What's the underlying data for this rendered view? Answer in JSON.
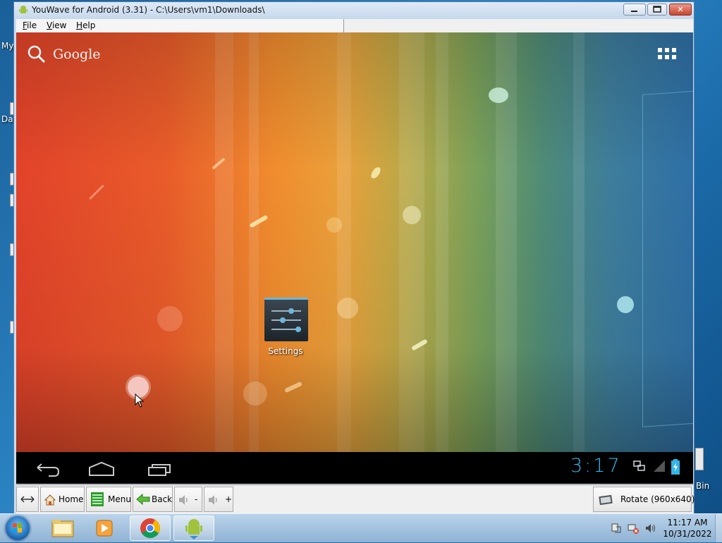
{
  "window": {
    "title": "YouWave for Android (3.31) - C:\\Users\\vm1\\Downloads\\",
    "minimize_glyph": "▭",
    "maximize_glyph": "▢",
    "close_glyph": "✕"
  },
  "menu": {
    "file": {
      "u": "F",
      "rest": "ile"
    },
    "view": {
      "u": "V",
      "rest": "iew"
    },
    "help": {
      "u": "H",
      "rest": "elp"
    }
  },
  "desktop": {
    "frag_my": "My",
    "frag_dat": "Dat",
    "frag_bin": "Bin"
  },
  "android": {
    "search_label": "Google",
    "settings_label": "Settings",
    "clock": "3:17",
    "icons": [
      "search-icon",
      "apps-grid-icon",
      "settings-app-icon",
      "back-nav-icon",
      "home-nav-icon",
      "recents-nav-icon",
      "network-icon",
      "signal-icon",
      "battery-icon"
    ]
  },
  "toolbar": {
    "home": "Home",
    "menu": "Menu",
    "back": "Back",
    "vol_down": "-",
    "vol_up": "+",
    "rotate": "Rotate (960x640)"
  },
  "taskbar": {
    "time": "11:17 AM",
    "date": "10/31/2022",
    "apps": [
      "explorer",
      "media-player",
      "chrome",
      "youwave"
    ]
  },
  "colors": {
    "accent_clock": "#33b5e5",
    "titlebar": "#c5d8ec",
    "close_button": "#c9452e"
  }
}
